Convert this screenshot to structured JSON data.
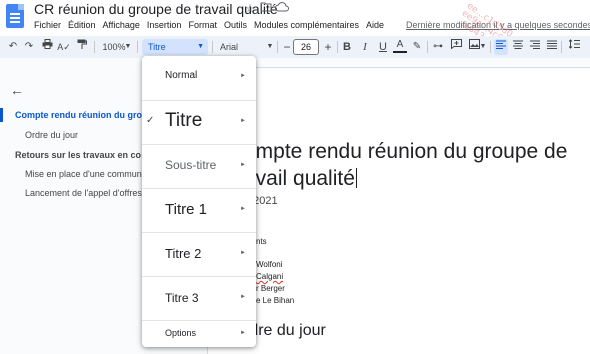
{
  "header": {
    "title": "CR réunion du groupe de travail qualité",
    "menus": [
      "Fichier",
      "Édition",
      "Affichage",
      "Insertion",
      "Format",
      "Outils",
      "Modules complémentaires",
      "Aide"
    ],
    "last_edit": "Dernière modification il y a quelques secondes",
    "icons": [
      "docs-logo-icon",
      "star-icon",
      "folder-move-icon",
      "cloud-status-icon"
    ]
  },
  "toolbar": {
    "zoom": "100%",
    "style": "Titre",
    "font": "Arial",
    "font_size": "26",
    "minus": "−",
    "plus": "+",
    "icons": [
      "undo-icon",
      "redo-icon",
      "print-icon",
      "spellcheck-icon",
      "paint-format-icon",
      "bold-icon",
      "italic-icon",
      "underline-icon",
      "text-color-icon",
      "highlight-icon",
      "link-icon",
      "comment-icon",
      "image-icon",
      "align-left-icon",
      "align-center-icon",
      "align-right-icon",
      "justify-icon",
      "line-spacing-icon"
    ]
  },
  "outline": {
    "items": [
      {
        "label": "Compte rendu réunion du groupe",
        "active": true
      },
      {
        "label": "Ordre du jour"
      },
      {
        "label": "Retours sur les travaux en co",
        "bold": true
      },
      {
        "label": "Mise en place d'une communau"
      },
      {
        "label": "Lancement de l'appel d'offres"
      }
    ]
  },
  "styles_menu": {
    "items": [
      {
        "label": "Normal"
      },
      {
        "label": "Titre",
        "checked": true
      },
      {
        "label": "Sous-titre"
      },
      {
        "label": "Titre 1"
      },
      {
        "label": "Titre 2"
      },
      {
        "label": "Titre 3"
      },
      {
        "label": "Options"
      }
    ],
    "check_glyph": "✓",
    "arrow_glyph": "►"
  },
  "document": {
    "title_line1": "ompte rendu réunion du groupe de",
    "title_line2": "avail qualité",
    "date": "n 2021",
    "lines": [
      "nts",
      "Wolfoni",
      "Calgani",
      "r Berger",
      "e Le Bihan"
    ],
    "heading": "rdre du jour"
  },
  "watermark": "ee...c1d5d0\nee9a...4c6...b6f\n...a643"
}
